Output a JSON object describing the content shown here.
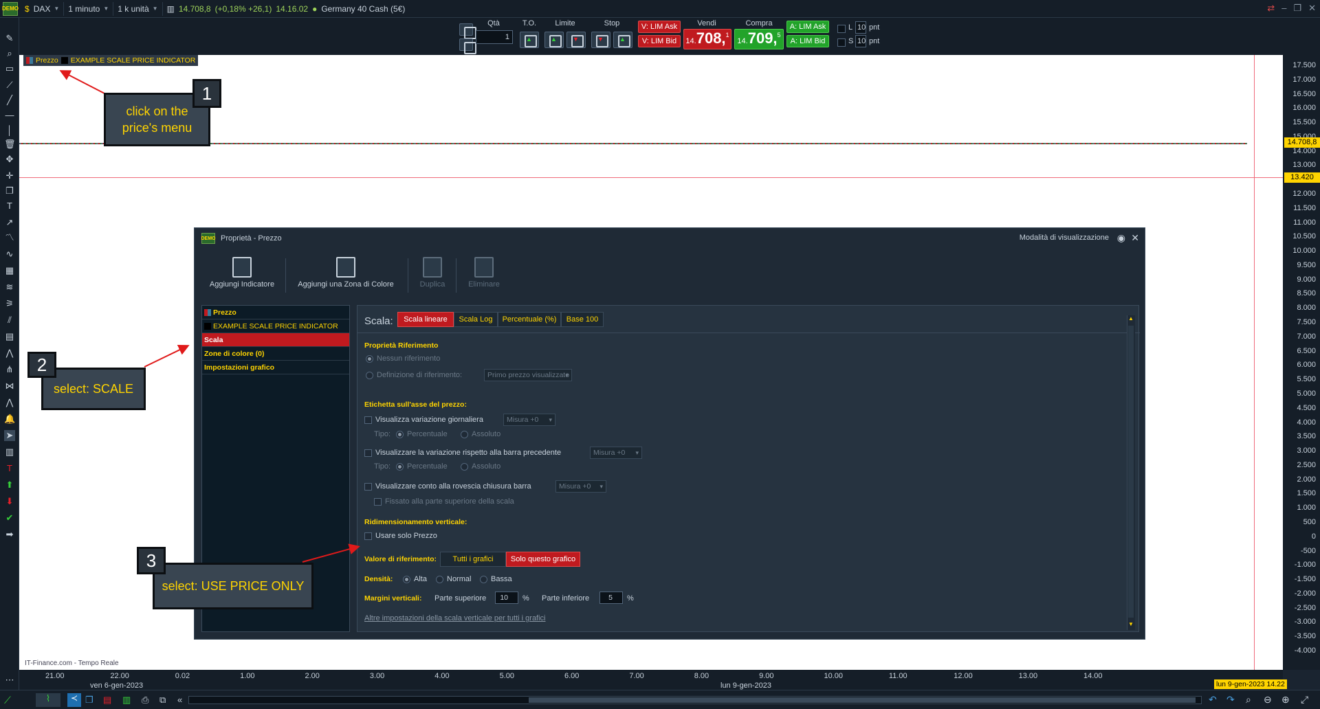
{
  "topbar": {
    "demo_badge": "DEMO",
    "instrument": "DAX",
    "timeframe": "1 minuto",
    "units": "1 k unità",
    "price": "14.708,8",
    "change": "(+0,18% +26,1)",
    "time": "14.16.02",
    "description": "Germany 40 Cash (5€)"
  },
  "tradebar": {
    "qta_label": "Qtà",
    "qta_value": "1",
    "to_label": "T.O.",
    "limite_label": "Limite",
    "stop_label": "Stop",
    "v_lim_ask": "V: LIM Ask",
    "v_lim_bid": "V: LIM Bid",
    "vendi_label": "Vendi",
    "vendi_prefix": "14.",
    "vendi_price": "708,",
    "vendi_suffix": "1",
    "compra_label": "Compra",
    "compra_prefix": "14.",
    "compra_price": "709,",
    "compra_suffix": "5",
    "a_lim_ask": "A: LIM Ask",
    "a_lim_bid": "A: LIM Bid",
    "l_label": "L",
    "s_label": "S",
    "l_value": "10",
    "s_value": "10",
    "pnt": "pnt"
  },
  "legend": {
    "price": "Prezzo",
    "indicator": "EXAMPLE SCALE PRICE INDICATOR"
  },
  "yaxis": {
    "ticks": [
      "17.500",
      "17.000",
      "16.500",
      "16.000",
      "15.500",
      "15.000",
      "14.000",
      "13.000",
      "12.500",
      "12.000",
      "11.500",
      "11.000",
      "10.500",
      "10.000",
      "9.500",
      "9.000",
      "8.500",
      "8.000",
      "7.500",
      "7.000",
      "6.500",
      "6.000",
      "5.500",
      "5.000",
      "4.500",
      "4.000",
      "3.500",
      "3.000",
      "2.500",
      "2.000",
      "1.500",
      "1.000",
      "500",
      "0",
      "-500",
      "-1.000",
      "-1.500",
      "-2.000",
      "-2.500",
      "-3.000",
      "-3.500",
      "-4.000"
    ],
    "price_label": "14.708,8",
    "crosshair_label": "13.420"
  },
  "xaxis": {
    "ticks": [
      "21.00",
      "22.00",
      "0.02",
      "1.00",
      "2.00",
      "3.00",
      "4.00",
      "5.00",
      "6.00",
      "7.00",
      "8.00",
      "9.00",
      "10.00",
      "11.00",
      "12.00",
      "13.00",
      "14.00"
    ],
    "date1": "ven 6-gen-2023",
    "date2": "lun 9-gen-2023",
    "cursor_label": "lun 9-gen-2023 14.22"
  },
  "footer_source": "IT-Finance.com - Tempo Reale",
  "dialog": {
    "title": "Proprietà - Prezzo",
    "view_mode": "Modalità di visualizzazione",
    "toolbar": {
      "add_indicator": "Aggiungi Indicatore",
      "add_color_zone": "Aggiungi una Zona di Colore",
      "duplicate": "Duplica",
      "delete": "Eliminare"
    },
    "left": {
      "prezzo": "Prezzo",
      "indicator": "EXAMPLE SCALE PRICE INDICATOR",
      "scala": "Scala",
      "zone": "Zone di colore (0)",
      "impostazioni": "Impostazioni grafico"
    },
    "right": {
      "scala_label": "Scala:",
      "tabs": [
        "Scala lineare",
        "Scala Log",
        "Percentuale (%)",
        "Base 100"
      ],
      "ref_props": "Proprietà Riferimento",
      "nessun_rif": "Nessun riferimento",
      "def_rif": "Definizione di riferimento:",
      "primo_prezzo": "Primo prezzo visualizzato",
      "etichetta": "Etichetta sull'asse del prezzo:",
      "var_giornaliera": "Visualizza variazione giornaliera",
      "misura": "Misura +0",
      "tipo": "Tipo:",
      "percentuale": "Percentuale",
      "assoluto": "Assoluto",
      "var_barra": "Visualizzare la variazione rispetto alla barra precedente",
      "conto_rovescia": "Visualizzare conto alla rovescia chiusura barra",
      "fissato": "Fissato alla parte superiore della scala",
      "ridimensionamento": "Ridimensionamento verticale:",
      "usare_prezzo": "Usare solo Prezzo",
      "valore_rif": "Valore di riferimento:",
      "tutti_grafici": "Tutti i grafici",
      "solo_grafico": "Solo questo grafico",
      "densita": "Densità:",
      "alta": "Alta",
      "normal": "Normal",
      "bassa": "Bassa",
      "margini": "Margini verticali:",
      "parte_sup": "Parte superiore",
      "parte_sup_val": "10",
      "parte_inf": "Parte inferiore",
      "parte_inf_val": "5",
      "pct": "%",
      "altre": "Altre impostazioni della scala verticale per tutti i grafici"
    }
  },
  "callouts": {
    "c1_num": "1",
    "c1_text": "click on the price's menu",
    "c2_num": "2",
    "c2_text": "select: SCALE",
    "c3_num": "3",
    "c3_text": "select: USE PRICE ONLY"
  },
  "colors": {
    "accent_red": "#c01a1f",
    "accent_green": "#22a32a",
    "label_yellow": "#ffd400"
  }
}
